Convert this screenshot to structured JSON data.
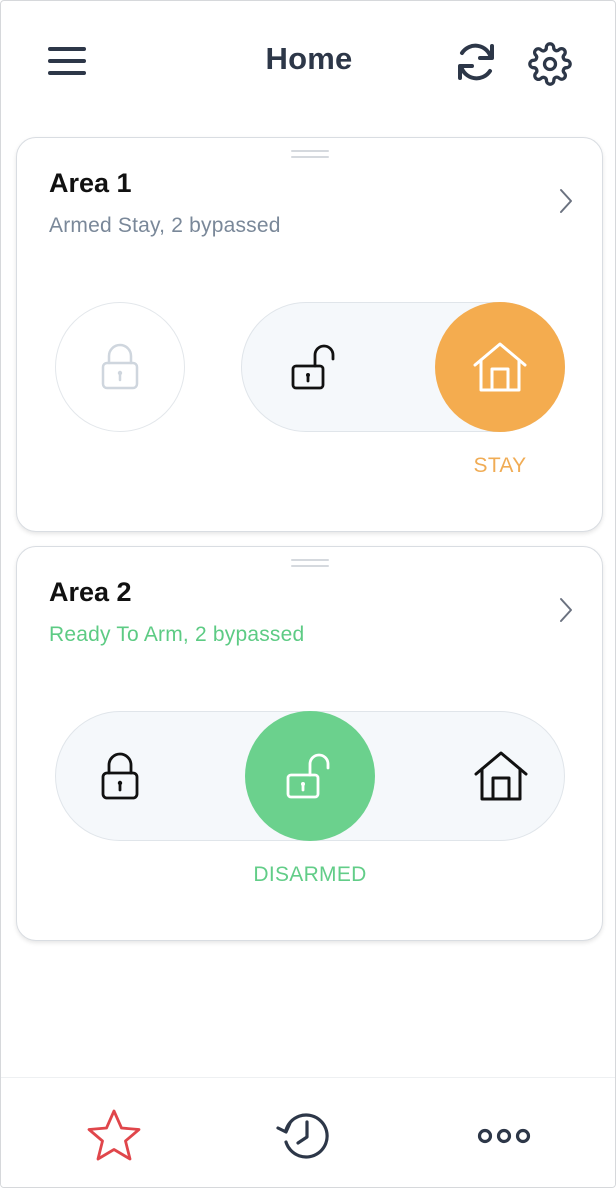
{
  "header": {
    "title": "Home",
    "icons": {
      "menu": "hamburger-menu-icon",
      "refresh": "refresh-icon",
      "settings": "gear-icon"
    }
  },
  "areas": [
    {
      "name": "Area 1",
      "status": "Armed Stay, 2 bypassed",
      "status_color": "#7a8899",
      "state_label": "STAY",
      "state_color": "#f4ac4f",
      "selected_mode": "stay",
      "modes": [
        "away",
        "disarm",
        "stay"
      ]
    },
    {
      "name": "Area 2",
      "status": "Ready To Arm, 2 bypassed",
      "status_color": "#5dcb84",
      "state_label": "DISARMED",
      "state_color": "#6bd18d",
      "selected_mode": "disarm",
      "modes": [
        "away",
        "disarm",
        "stay"
      ]
    }
  ],
  "bottom_nav": {
    "items": [
      "favorites-star-icon",
      "history-icon",
      "more-dots-icon"
    ],
    "active": "favorites",
    "active_color": "#e0464b",
    "inactive_color": "#2d3748"
  },
  "colors": {
    "title_text": "#2d3748",
    "stay_orange": "#f4ac4f",
    "disarmed_green": "#6bd18d",
    "track_bg": "#f5f8fb"
  }
}
